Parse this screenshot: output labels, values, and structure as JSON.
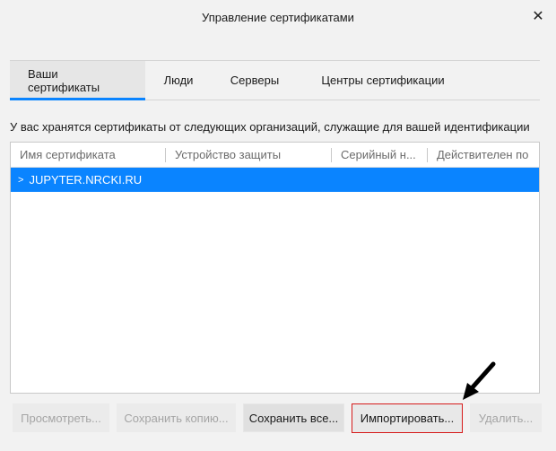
{
  "window": {
    "title": "Управление сертификатами"
  },
  "tabs": [
    {
      "label": "Ваши сертификаты",
      "active": true
    },
    {
      "label": "Люди",
      "active": false
    },
    {
      "label": "Серверы",
      "active": false
    },
    {
      "label": "Центры сертификации",
      "active": false
    }
  ],
  "description": "У вас хранятся сертификаты от следующих организаций, служащие для вашей идентификации",
  "table": {
    "columns": [
      "Имя сертификата",
      "Устройство защиты",
      "Серийный н...",
      "Действителен по"
    ],
    "rows": [
      {
        "name": "JUPYTER.NRCKI.RU",
        "selected": true
      }
    ]
  },
  "buttons": {
    "view": "Просмотреть...",
    "backup": "Сохранить копию...",
    "backup_all": "Сохранить все...",
    "import": "Импортировать...",
    "delete": "Удалить..."
  },
  "colors": {
    "accent": "#0a84ff",
    "highlight_border": "#d61a1a"
  }
}
